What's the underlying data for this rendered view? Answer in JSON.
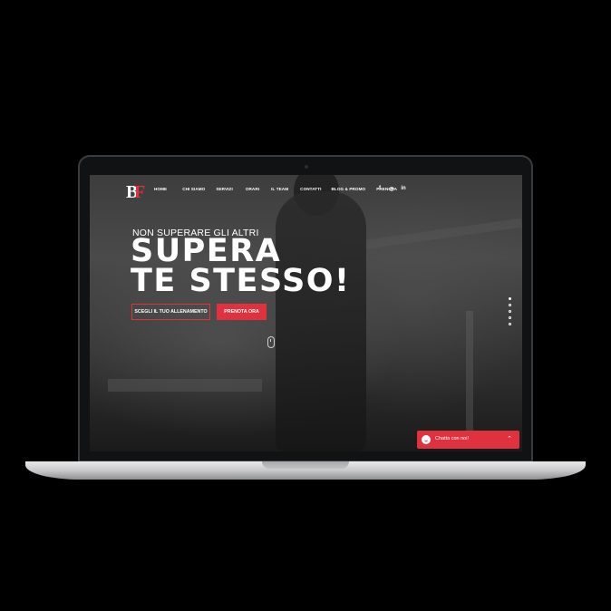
{
  "nav": {
    "items": [
      "HOME",
      "CHI SIAMO",
      "SERVIZI",
      "ORARI",
      "IL TEAM",
      "CONTATTI",
      "BLOG & PROMO",
      "PRENOTA"
    ],
    "social": [
      "f",
      "◎",
      "in"
    ]
  },
  "hero": {
    "kicker": "NON SUPERARE GLI ALTRI",
    "title_line1": "SUPERA",
    "title_line2": "TE STESSO!",
    "cta_secondary": "SCEGLI IL TUO ALLENAMENTO",
    "cta_primary": "PRENOTA ORA"
  },
  "slider": {
    "dot_count": 5,
    "active_index": 0
  },
  "chat": {
    "label": "Chatta con noi!"
  },
  "colors": {
    "accent": "#e0313e",
    "background": "#000000"
  }
}
